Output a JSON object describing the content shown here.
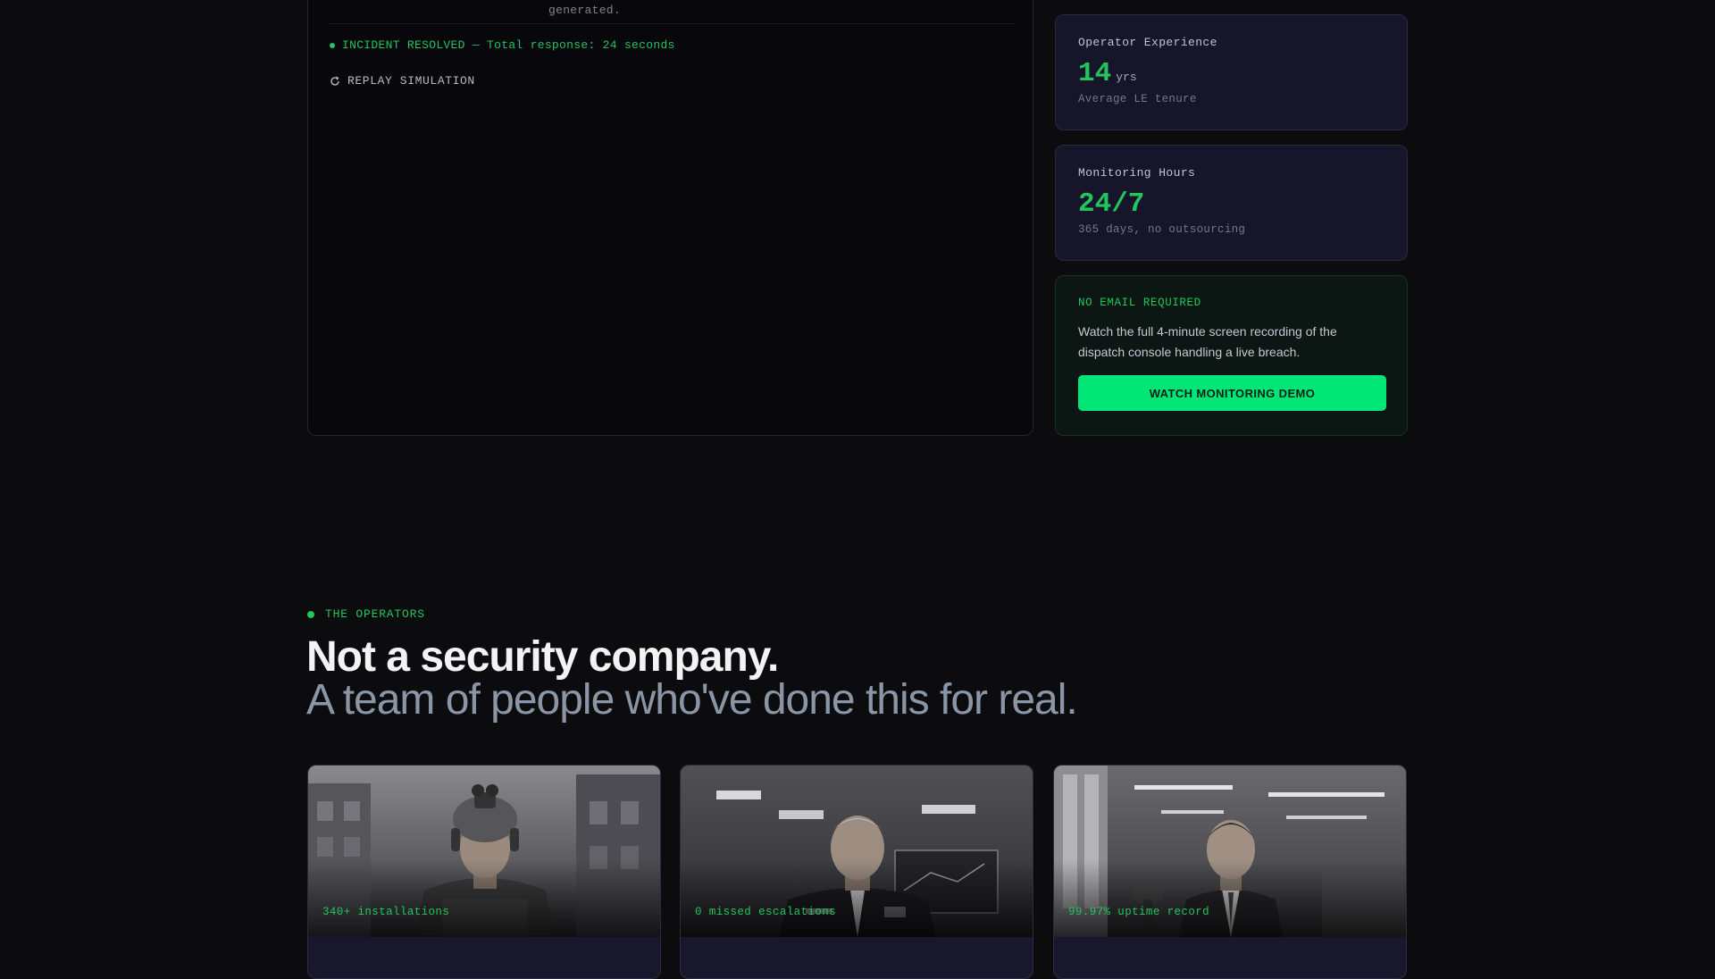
{
  "terminal": {
    "previous_line": "generated.",
    "resolved_text": "INCIDENT RESOLVED — Total response: 24 seconds",
    "replay_label": "REPLAY SIMULATION"
  },
  "stats": [
    {
      "label": "Operator Experience",
      "value": "14",
      "unit": "yrs",
      "sub": "Average LE tenure"
    },
    {
      "label": "Monitoring Hours",
      "value": "24/7",
      "unit": "",
      "sub": "365 days, no outsourcing"
    }
  ],
  "demo": {
    "tag": "NO EMAIL REQUIRED",
    "text": "Watch the full 4-minute screen recording of the dispatch console handling a live breach.",
    "button_label": "WATCH MONITORING DEMO"
  },
  "operators": {
    "tag": "THE OPERATORS",
    "headline": "Not a security company.",
    "subheadline": "A team of people who've done this for real.",
    "cards": [
      {
        "caption": "340+ installations"
      },
      {
        "caption": "0 missed escalations"
      },
      {
        "caption": "99.97% uptime record"
      }
    ]
  },
  "colors": {
    "accent": "#22c55e",
    "button": "#00e676",
    "background": "#0c0c0f",
    "card": "#16152a"
  }
}
